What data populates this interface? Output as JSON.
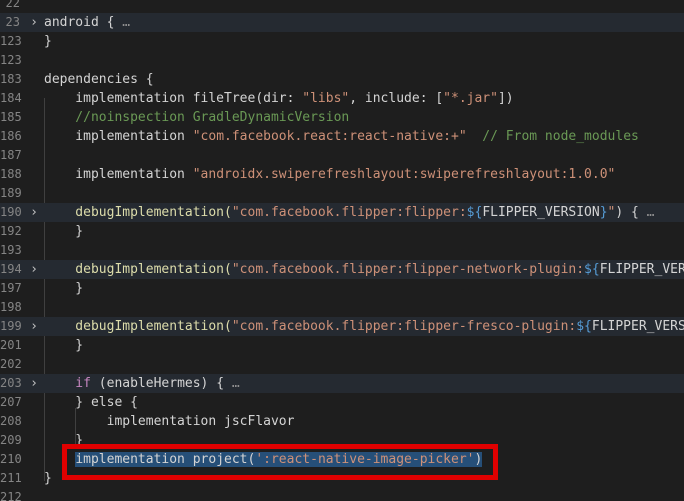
{
  "theme": {
    "background": "#1e1e1e",
    "highlight_color": "#e00000",
    "selection": "#264f78"
  },
  "lines": [
    {
      "num": "22",
      "tokens": []
    },
    {
      "num": "23",
      "fold": "›",
      "folded": true,
      "tokens": [
        {
          "t": "android {",
          "c": "plain"
        },
        {
          "t": " … ",
          "c": "ellipsis"
        }
      ]
    },
    {
      "num": "123",
      "tokens": [
        {
          "t": "}",
          "c": "plain"
        }
      ]
    },
    {
      "num": "123",
      "tokens": []
    },
    {
      "num": "183",
      "tokens": [
        {
          "t": "dependencies {",
          "c": "plain"
        }
      ]
    },
    {
      "num": "184",
      "tokens": [
        {
          "t": "    implementation fileTree(dir: ",
          "c": "plain"
        },
        {
          "t": "\"libs\"",
          "c": "str"
        },
        {
          "t": ", include: [",
          "c": "plain"
        },
        {
          "t": "\"*.jar\"",
          "c": "str"
        },
        {
          "t": "])",
          "c": "plain"
        }
      ]
    },
    {
      "num": "185",
      "tokens": [
        {
          "t": "    //noinspection GradleDynamicVersion",
          "c": "comment"
        }
      ]
    },
    {
      "num": "186",
      "tokens": [
        {
          "t": "    implementation ",
          "c": "plain"
        },
        {
          "t": "\"com.facebook.react:react-native:+\"",
          "c": "str"
        },
        {
          "t": "  // From node_modules",
          "c": "comment"
        }
      ]
    },
    {
      "num": "187",
      "tokens": []
    },
    {
      "num": "188",
      "tokens": [
        {
          "t": "    implementation ",
          "c": "plain"
        },
        {
          "t": "\"androidx.swiperefreshlayout:swiperefreshlayout:1.0.0\"",
          "c": "str"
        }
      ]
    },
    {
      "num": "189",
      "tokens": []
    },
    {
      "num": "190",
      "fold": "›",
      "folded": true,
      "tokens": [
        {
          "t": "    debugImplementation(",
          "c": "fn"
        },
        {
          "t": "\"com.facebook.flipper:flipper:",
          "c": "str"
        },
        {
          "t": "${",
          "c": "interp"
        },
        {
          "t": "FLIPPER_VERSION",
          "c": "plain"
        },
        {
          "t": "}",
          "c": "interp"
        },
        {
          "t": "\"",
          "c": "str"
        },
        {
          "t": ") {",
          "c": "plain"
        },
        {
          "t": " … ",
          "c": "ellipsis"
        }
      ]
    },
    {
      "num": "192",
      "tokens": [
        {
          "t": "    }",
          "c": "plain"
        }
      ]
    },
    {
      "num": "193",
      "tokens": []
    },
    {
      "num": "194",
      "fold": "›",
      "folded": true,
      "tokens": [
        {
          "t": "    debugImplementation(",
          "c": "fn"
        },
        {
          "t": "\"com.facebook.flipper:flipper-network-plugin:",
          "c": "str"
        },
        {
          "t": "${",
          "c": "interp"
        },
        {
          "t": "FLIPPER_VERS",
          "c": "plain"
        }
      ]
    },
    {
      "num": "197",
      "tokens": [
        {
          "t": "    }",
          "c": "plain"
        }
      ]
    },
    {
      "num": "198",
      "tokens": []
    },
    {
      "num": "199",
      "fold": "›",
      "folded": true,
      "tokens": [
        {
          "t": "    debugImplementation(",
          "c": "fn"
        },
        {
          "t": "\"com.facebook.flipper:flipper-fresco-plugin:",
          "c": "str"
        },
        {
          "t": "${",
          "c": "interp"
        },
        {
          "t": "FLIPPER_VERSIO",
          "c": "plain"
        }
      ]
    },
    {
      "num": "201",
      "tokens": [
        {
          "t": "    }",
          "c": "plain"
        }
      ]
    },
    {
      "num": "202",
      "tokens": []
    },
    {
      "num": "203",
      "fold": "›",
      "folded": true,
      "tokens": [
        {
          "t": "    if",
          "c": "key"
        },
        {
          "t": " (",
          "c": "plain"
        },
        {
          "t": "enableHermes",
          "c": "plain"
        },
        {
          "t": ") {",
          "c": "plain"
        },
        {
          "t": " … ",
          "c": "ellipsis"
        }
      ]
    },
    {
      "num": "207",
      "tokens": [
        {
          "t": "    } else {",
          "c": "plain"
        }
      ]
    },
    {
      "num": "208",
      "tokens": [
        {
          "t": "        implementation jscFlavor",
          "c": "plain"
        }
      ]
    },
    {
      "num": "209",
      "tokens": [
        {
          "t": "    }",
          "c": "plain"
        }
      ]
    },
    {
      "num": "210",
      "selected": true,
      "tokens": [
        {
          "t": "    ",
          "c": "plain"
        },
        {
          "t": "implementation project(",
          "c": "plain",
          "sel": true
        },
        {
          "t": "':react-native-image-picker'",
          "c": "str",
          "sel": true
        },
        {
          "t": ")",
          "c": "plain",
          "sel": true
        }
      ]
    },
    {
      "num": "211",
      "tokens": [
        {
          "t": "}",
          "c": "plain"
        }
      ]
    },
    {
      "num": "212",
      "tokens": []
    }
  ]
}
